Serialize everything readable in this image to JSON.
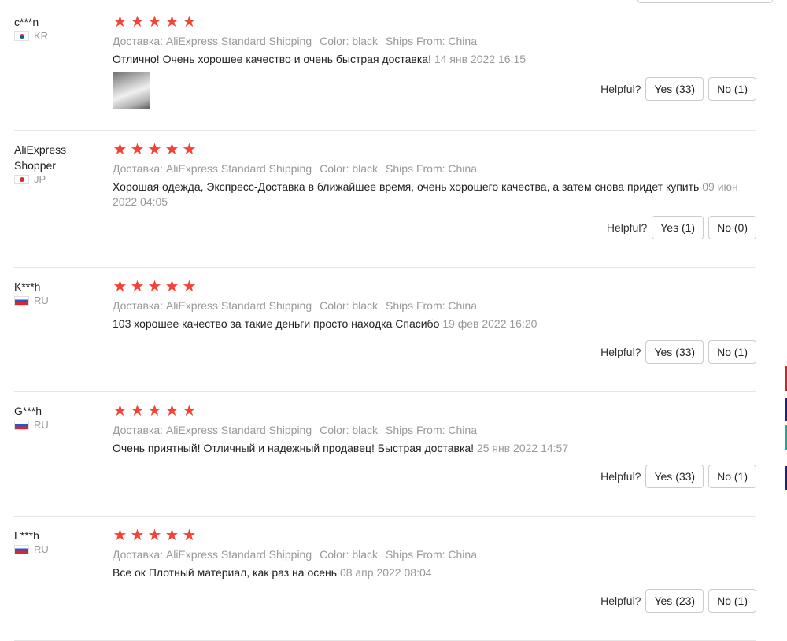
{
  "labels": {
    "helpful": "Helpful?"
  },
  "reviews": [
    {
      "user": "c***n",
      "country": "KR",
      "flag": "kr",
      "stars": 5,
      "delivery": "Доставка: AliExpress Standard Shipping",
      "color": "Color: black",
      "ships_from": "Ships From: China",
      "text": "Отлично! Очень хорошее качество и очень быстрая доставка!",
      "date": "14 янв 2022 16:15",
      "yes": "Yes (33)",
      "no": "No (1)"
    },
    {
      "user": "AliExpress Shopper",
      "country": "JP",
      "flag": "jp",
      "stars": 5,
      "delivery": "Доставка: AliExpress Standard Shipping",
      "color": "Color: black",
      "ships_from": "Ships From: China",
      "text": "Хорошая одежда, Экспресс-Доставка в ближайшее время, очень хорошего качества, а затем снова придет купить",
      "date": "09 июн 2022 04:05",
      "yes": "Yes (1)",
      "no": "No (0)"
    },
    {
      "user": "K***h",
      "country": "RU",
      "flag": "ru",
      "stars": 5,
      "delivery": "Доставка: AliExpress Standard Shipping",
      "color": "Color: black",
      "ships_from": "Ships From: China",
      "text": "103 хорошее качество за такие деньги просто находка Спасибо",
      "date": "19 фев 2022 16:20",
      "yes": "Yes (33)",
      "no": "No (1)"
    },
    {
      "user": "G***h",
      "country": "RU",
      "flag": "ru",
      "stars": 5,
      "delivery": "Доставка: AliExpress Standard Shipping",
      "color": "Color: black",
      "ships_from": "Ships From: China",
      "text": "Очень приятный! Отличный и надежный продавец! Быстрая доставка!",
      "date": "25 янв 2022 14:57",
      "yes": "Yes (33)",
      "no": "No (1)"
    },
    {
      "user": "L***h",
      "country": "RU",
      "flag": "ru",
      "stars": 5,
      "delivery": "Доставка: AliExpress Standard Shipping",
      "color": "Color: black",
      "ships_from": "Ships From: China",
      "text": "Все ок Плотный материал, как раз на осень",
      "date": "08 апр 2022 08:04",
      "yes": "Yes (23)",
      "no": "No (1)"
    }
  ],
  "colors": {
    "star": "#f44336",
    "muted_text": "#999999",
    "divider": "#e6e6e6"
  }
}
